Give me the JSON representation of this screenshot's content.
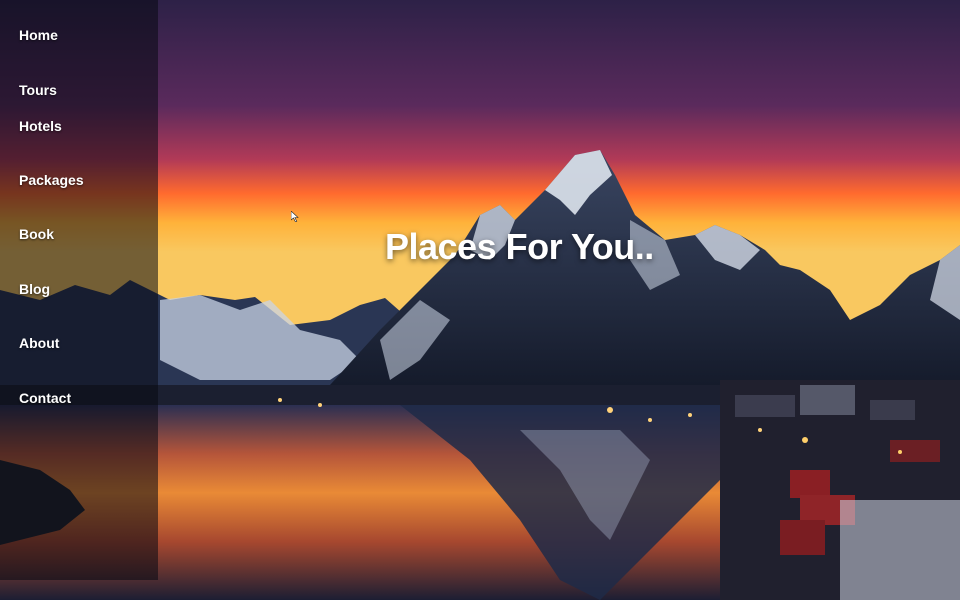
{
  "nav": {
    "items": [
      {
        "label": "Home"
      },
      {
        "label": "Tours"
      },
      {
        "label": "Hotels"
      },
      {
        "label": "Packages"
      },
      {
        "label": "Book"
      },
      {
        "label": "Blog"
      },
      {
        "label": "About"
      },
      {
        "label": "Contact"
      }
    ]
  },
  "hero": {
    "headline": "Places For You.."
  },
  "colors": {
    "sky_top": "#3a1f4f",
    "sky_mid": "#6e2c5f",
    "sunset": "#ff8a2a",
    "water": "#1d2a4a",
    "nav_text": "#ffffff"
  }
}
